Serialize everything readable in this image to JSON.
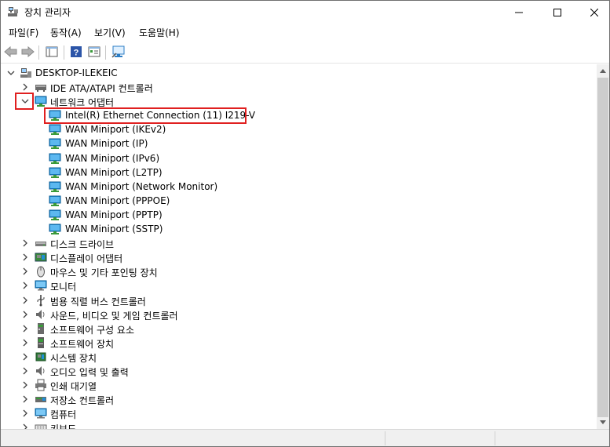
{
  "window": {
    "title": "장치 관리자"
  },
  "menu": [
    "파일(F)",
    "동작(A)",
    "보기(V)",
    "도움말(H)"
  ],
  "tree": {
    "root": "DESKTOP-ILEKEIC",
    "categories": [
      {
        "label": "IDE ATA/ATAPI 컨트롤러",
        "icon": "ide-controller-icon"
      },
      {
        "label": "네트워크 어댑터",
        "icon": "network-adapter-icon",
        "expanded": true,
        "children": [
          "Intel(R) Ethernet Connection (11) I219-V",
          "WAN Miniport (IKEv2)",
          "WAN Miniport (IP)",
          "WAN Miniport (IPv6)",
          "WAN Miniport (L2TP)",
          "WAN Miniport (Network Monitor)",
          "WAN Miniport (PPPOE)",
          "WAN Miniport (PPTP)",
          "WAN Miniport (SSTP)"
        ]
      },
      {
        "label": "디스크 드라이브",
        "icon": "disk-drive-icon"
      },
      {
        "label": "디스플레이 어댑터",
        "icon": "display-adapter-icon"
      },
      {
        "label": "마우스 및 기타 포인팅 장치",
        "icon": "mouse-icon"
      },
      {
        "label": "모니터",
        "icon": "monitor-icon"
      },
      {
        "label": "범용 직렬 버스 컨트롤러",
        "icon": "usb-controller-icon"
      },
      {
        "label": "사운드, 비디오 및 게임 컨트롤러",
        "icon": "sound-icon"
      },
      {
        "label": "소프트웨어 구성 요소",
        "icon": "software-component-icon"
      },
      {
        "label": "소프트웨어 장치",
        "icon": "software-device-icon"
      },
      {
        "label": "시스템 장치",
        "icon": "system-device-icon"
      },
      {
        "label": "오디오 입력 및 출력",
        "icon": "audio-io-icon"
      },
      {
        "label": "인쇄 대기열",
        "icon": "print-queue-icon"
      },
      {
        "label": "저장소 컨트롤러",
        "icon": "storage-controller-icon"
      },
      {
        "label": "컴퓨터",
        "icon": "computer-icon"
      },
      {
        "label": "키보드",
        "icon": "keyboard-icon"
      }
    ]
  },
  "colors": {
    "highlight_border": "#e02020",
    "adapter_blue": "#1e8fd6"
  }
}
